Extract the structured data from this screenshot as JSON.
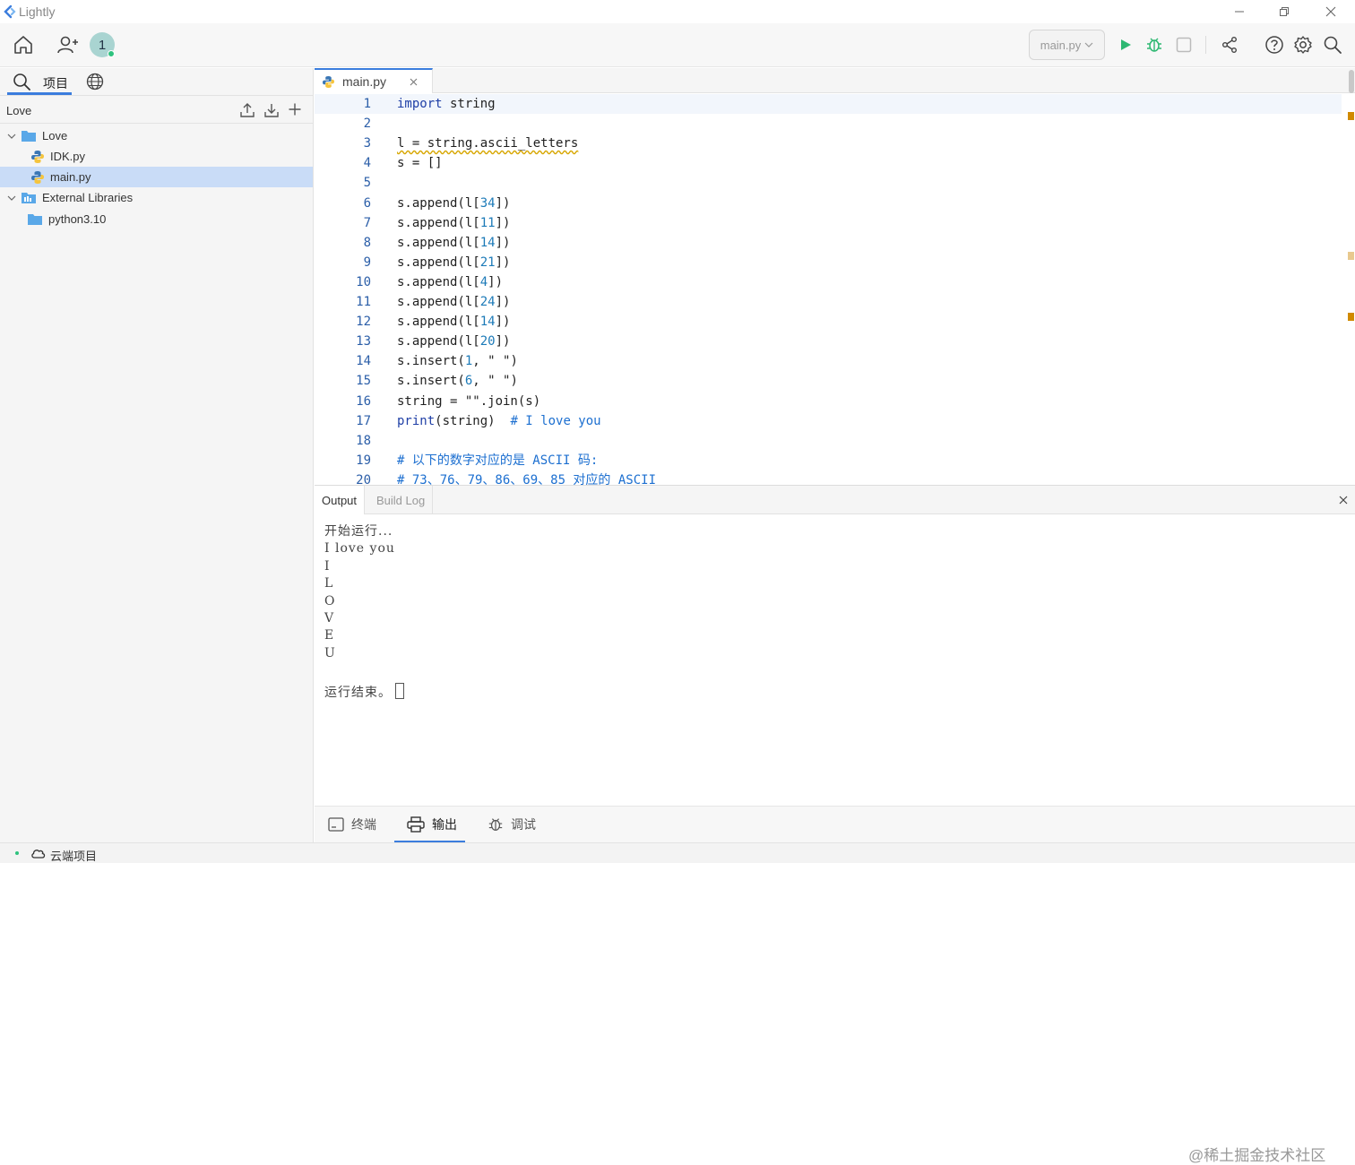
{
  "window": {
    "title": "Lightly"
  },
  "toolbar": {
    "avatar_initial": "1",
    "run_target": "main.py"
  },
  "sidebar": {
    "tab_project": "项目",
    "header_title": "Love",
    "tree": [
      {
        "label": "Love",
        "type": "folder",
        "level": 0,
        "expanded": true,
        "selected": false
      },
      {
        "label": "IDK.py",
        "type": "python-file",
        "level": 1,
        "selected": false
      },
      {
        "label": "main.py",
        "type": "python-file",
        "level": 1,
        "selected": true
      },
      {
        "label": "External Libraries",
        "type": "library-folder",
        "level": 0,
        "expanded": true,
        "selected": false
      },
      {
        "label": "python3.10",
        "type": "folder",
        "level": 1,
        "selected": false
      }
    ]
  },
  "editor": {
    "tab_name": "main.py",
    "lines": [
      {
        "n": "1",
        "tokens": [
          {
            "t": "import",
            "c": "kw"
          },
          {
            "t": " string",
            "c": ""
          }
        ]
      },
      {
        "n": "2",
        "tokens": []
      },
      {
        "n": "3",
        "tokens": [
          {
            "t": "l = string.ascii_letters",
            "c": "wavy"
          }
        ]
      },
      {
        "n": "4",
        "tokens": [
          {
            "t": "s = []",
            "c": ""
          }
        ]
      },
      {
        "n": "5",
        "tokens": []
      },
      {
        "n": "6",
        "tokens": [
          {
            "t": "s.append(l[",
            "c": ""
          },
          {
            "t": "34",
            "c": "num"
          },
          {
            "t": "])",
            "c": ""
          }
        ]
      },
      {
        "n": "7",
        "tokens": [
          {
            "t": "s.append(l[",
            "c": ""
          },
          {
            "t": "11",
            "c": "num"
          },
          {
            "t": "])",
            "c": ""
          }
        ]
      },
      {
        "n": "8",
        "tokens": [
          {
            "t": "s.append(l[",
            "c": ""
          },
          {
            "t": "14",
            "c": "num"
          },
          {
            "t": "])",
            "c": ""
          }
        ]
      },
      {
        "n": "9",
        "tokens": [
          {
            "t": "s.append(l[",
            "c": ""
          },
          {
            "t": "21",
            "c": "num"
          },
          {
            "t": "])",
            "c": ""
          }
        ]
      },
      {
        "n": "10",
        "tokens": [
          {
            "t": "s.append(l[",
            "c": ""
          },
          {
            "t": "4",
            "c": "num"
          },
          {
            "t": "])",
            "c": ""
          }
        ]
      },
      {
        "n": "11",
        "tokens": [
          {
            "t": "s.append(l[",
            "c": ""
          },
          {
            "t": "24",
            "c": "num"
          },
          {
            "t": "])",
            "c": ""
          }
        ]
      },
      {
        "n": "12",
        "tokens": [
          {
            "t": "s.append(l[",
            "c": ""
          },
          {
            "t": "14",
            "c": "num"
          },
          {
            "t": "])",
            "c": ""
          }
        ]
      },
      {
        "n": "13",
        "tokens": [
          {
            "t": "s.append(l[",
            "c": ""
          },
          {
            "t": "20",
            "c": "num"
          },
          {
            "t": "])",
            "c": ""
          }
        ]
      },
      {
        "n": "14",
        "tokens": [
          {
            "t": "s.insert(",
            "c": ""
          },
          {
            "t": "1",
            "c": "num"
          },
          {
            "t": ", \" \")",
            "c": ""
          }
        ]
      },
      {
        "n": "15",
        "tokens": [
          {
            "t": "s.insert(",
            "c": ""
          },
          {
            "t": "6",
            "c": "num"
          },
          {
            "t": ", \" \")",
            "c": ""
          }
        ]
      },
      {
        "n": "16",
        "tokens": [
          {
            "t": "string = \"\".join(s)",
            "c": ""
          }
        ]
      },
      {
        "n": "17",
        "tokens": [
          {
            "t": "print",
            "c": "kw"
          },
          {
            "t": "(string)  ",
            "c": ""
          },
          {
            "t": "# I love you",
            "c": "cmt"
          }
        ]
      },
      {
        "n": "18",
        "tokens": []
      },
      {
        "n": "19",
        "tokens": [
          {
            "t": "# 以下的数字对应的是 ASCII 码:",
            "c": "cmt"
          }
        ]
      },
      {
        "n": "20",
        "tokens": [
          {
            "t": "# 73、76、79、86、69、85 对应的 ASCII",
            "c": "cmt"
          }
        ]
      }
    ]
  },
  "output": {
    "tab_output": "Output",
    "tab_build_log": "Build Log",
    "console_lines": [
      "开始运行...",
      "I love you",
      "I",
      "L",
      "O",
      "V",
      "E",
      "U",
      ""
    ],
    "console_end": "运行结束。"
  },
  "bottom_tabs": {
    "terminal": "终端",
    "output": "输出",
    "debug": "调试"
  },
  "watermark": "@稀土掘金技术社区",
  "statusbar": {
    "cloud_project": "云端项目"
  }
}
